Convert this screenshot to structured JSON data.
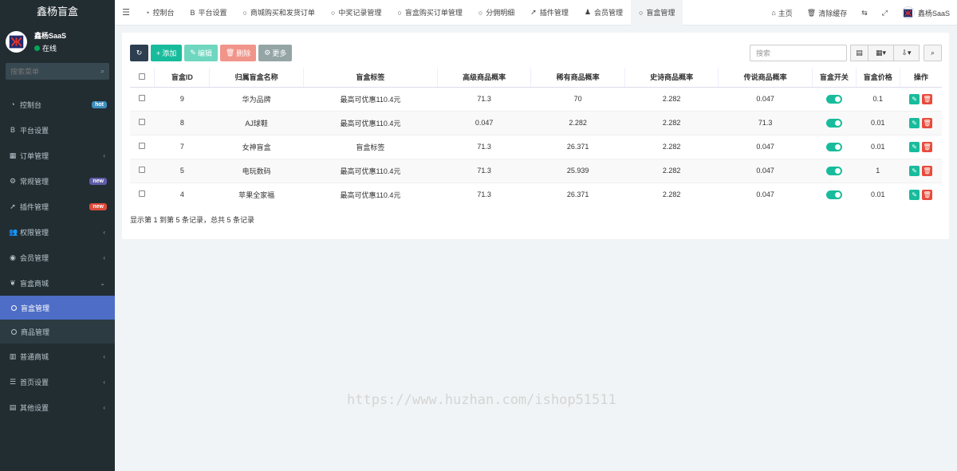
{
  "brand": "鑫杨盲盒",
  "user": {
    "name": "鑫杨SaaS",
    "status": "在线"
  },
  "search_placeholder": "搜索菜单",
  "menu": [
    {
      "label": "控制台",
      "icon": "dashboard-icon",
      "badge": "hot"
    },
    {
      "label": "平台设置",
      "icon": "bold-b-icon"
    },
    {
      "label": "订单管理",
      "icon": "table-icon",
      "arrow": true
    },
    {
      "label": "常规管理",
      "icon": "cogs-icon",
      "badge": "new"
    },
    {
      "label": "插件管理",
      "icon": "rocket-icon",
      "badge": "new"
    },
    {
      "label": "权限管理",
      "icon": "group-icon",
      "arrow": true
    },
    {
      "label": "会员管理",
      "icon": "user-circle-icon",
      "arrow": true
    },
    {
      "label": "盲盒商城",
      "icon": "leaf-icon",
      "expanded": true
    }
  ],
  "submenu": [
    {
      "label": "盲盒管理",
      "active": true
    },
    {
      "label": "商品管理"
    }
  ],
  "menu2": [
    {
      "label": "普通商城",
      "icon": "bank-icon"
    },
    {
      "label": "首页设置",
      "icon": "list-icon"
    },
    {
      "label": "其他设置",
      "icon": "database-icon"
    }
  ],
  "tabs": [
    {
      "label": "控制台",
      "icon": "dashboard-icon"
    },
    {
      "label": "平台设置",
      "icon": "bold-b-icon"
    },
    {
      "label": "商城购买和发货订单",
      "icon": "circle-icon"
    },
    {
      "label": "中奖记录管理",
      "icon": "circle-icon"
    },
    {
      "label": "盲盒购买订单管理",
      "icon": "circle-icon"
    },
    {
      "label": "分佣明细",
      "icon": "circle-icon"
    },
    {
      "label": "插件管理",
      "icon": "rocket-icon"
    },
    {
      "label": "会员管理",
      "icon": "users-icon"
    },
    {
      "label": "盲盒管理",
      "icon": "circle-icon",
      "active": true
    }
  ],
  "topright": {
    "home": "主页",
    "clear_cache": "清除缓存",
    "user": "鑫杨SaaS"
  },
  "toolbar": {
    "add": "添加",
    "edit": "编辑",
    "delete": "删除",
    "more": "更多",
    "search_placeholder": "搜索"
  },
  "table": {
    "headers": [
      "盲盒ID",
      "归属盲盒名称",
      "盲盒标签",
      "高级商品概率",
      "稀有商品概率",
      "史诗商品概率",
      "传说商品概率",
      "盲盒开关",
      "盲盒价格",
      "操作"
    ],
    "rows": [
      [
        "9",
        "华为品牌",
        "最高可优惠110.4元",
        "71.3",
        "70",
        "2.282",
        "0.047",
        "on",
        "0.1"
      ],
      [
        "8",
        "AJ球鞋",
        "最高可优惠110.4元",
        "0.047",
        "2.282",
        "2.282",
        "71.3",
        "on",
        "0.01"
      ],
      [
        "7",
        "女神盲盒",
        "盲盒标签",
        "71.3",
        "26.371",
        "2.282",
        "0.047",
        "on",
        "0.01"
      ],
      [
        "5",
        "电玩数码",
        "最高可优惠110.4元",
        "71.3",
        "25.939",
        "2.282",
        "0.047",
        "on",
        "1"
      ],
      [
        "4",
        "苹果全家福",
        "最高可优惠110.4元",
        "71.3",
        "26.371",
        "2.282",
        "0.047",
        "on",
        "0.01"
      ]
    ]
  },
  "pager": "显示第 1 到第 5 条记录，总共 5 条记录",
  "watermark": "https://www.huzhan.com/ishop51511",
  "colors": {
    "sidebar": "#222d32",
    "active": "#4e6dc6",
    "green": "#18bc9c",
    "red": "#e74c3c"
  }
}
